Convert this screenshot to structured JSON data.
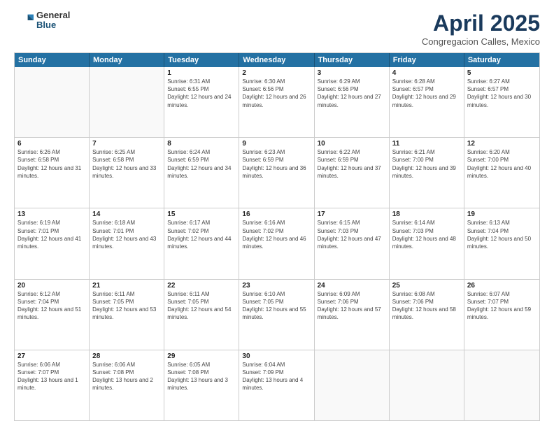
{
  "header": {
    "logo": {
      "general": "General",
      "blue": "Blue"
    },
    "title": "April 2025",
    "subtitle": "Congregacion Calles, Mexico"
  },
  "calendar": {
    "days_of_week": [
      "Sunday",
      "Monday",
      "Tuesday",
      "Wednesday",
      "Thursday",
      "Friday",
      "Saturday"
    ],
    "weeks": [
      {
        "cells": [
          {
            "day": "",
            "empty": true
          },
          {
            "day": "",
            "empty": true
          },
          {
            "day": "1",
            "sunrise": "6:31 AM",
            "sunset": "6:55 PM",
            "daylight": "12 hours and 24 minutes."
          },
          {
            "day": "2",
            "sunrise": "6:30 AM",
            "sunset": "6:56 PM",
            "daylight": "12 hours and 26 minutes."
          },
          {
            "day": "3",
            "sunrise": "6:29 AM",
            "sunset": "6:56 PM",
            "daylight": "12 hours and 27 minutes."
          },
          {
            "day": "4",
            "sunrise": "6:28 AM",
            "sunset": "6:57 PM",
            "daylight": "12 hours and 29 minutes."
          },
          {
            "day": "5",
            "sunrise": "6:27 AM",
            "sunset": "6:57 PM",
            "daylight": "12 hours and 30 minutes."
          }
        ]
      },
      {
        "cells": [
          {
            "day": "6",
            "sunrise": "6:26 AM",
            "sunset": "6:58 PM",
            "daylight": "12 hours and 31 minutes."
          },
          {
            "day": "7",
            "sunrise": "6:25 AM",
            "sunset": "6:58 PM",
            "daylight": "12 hours and 33 minutes."
          },
          {
            "day": "8",
            "sunrise": "6:24 AM",
            "sunset": "6:59 PM",
            "daylight": "12 hours and 34 minutes."
          },
          {
            "day": "9",
            "sunrise": "6:23 AM",
            "sunset": "6:59 PM",
            "daylight": "12 hours and 36 minutes."
          },
          {
            "day": "10",
            "sunrise": "6:22 AM",
            "sunset": "6:59 PM",
            "daylight": "12 hours and 37 minutes."
          },
          {
            "day": "11",
            "sunrise": "6:21 AM",
            "sunset": "7:00 PM",
            "daylight": "12 hours and 39 minutes."
          },
          {
            "day": "12",
            "sunrise": "6:20 AM",
            "sunset": "7:00 PM",
            "daylight": "12 hours and 40 minutes."
          }
        ]
      },
      {
        "cells": [
          {
            "day": "13",
            "sunrise": "6:19 AM",
            "sunset": "7:01 PM",
            "daylight": "12 hours and 41 minutes."
          },
          {
            "day": "14",
            "sunrise": "6:18 AM",
            "sunset": "7:01 PM",
            "daylight": "12 hours and 43 minutes."
          },
          {
            "day": "15",
            "sunrise": "6:17 AM",
            "sunset": "7:02 PM",
            "daylight": "12 hours and 44 minutes."
          },
          {
            "day": "16",
            "sunrise": "6:16 AM",
            "sunset": "7:02 PM",
            "daylight": "12 hours and 46 minutes."
          },
          {
            "day": "17",
            "sunrise": "6:15 AM",
            "sunset": "7:03 PM",
            "daylight": "12 hours and 47 minutes."
          },
          {
            "day": "18",
            "sunrise": "6:14 AM",
            "sunset": "7:03 PM",
            "daylight": "12 hours and 48 minutes."
          },
          {
            "day": "19",
            "sunrise": "6:13 AM",
            "sunset": "7:04 PM",
            "daylight": "12 hours and 50 minutes."
          }
        ]
      },
      {
        "cells": [
          {
            "day": "20",
            "sunrise": "6:12 AM",
            "sunset": "7:04 PM",
            "daylight": "12 hours and 51 minutes."
          },
          {
            "day": "21",
            "sunrise": "6:11 AM",
            "sunset": "7:05 PM",
            "daylight": "12 hours and 53 minutes."
          },
          {
            "day": "22",
            "sunrise": "6:11 AM",
            "sunset": "7:05 PM",
            "daylight": "12 hours and 54 minutes."
          },
          {
            "day": "23",
            "sunrise": "6:10 AM",
            "sunset": "7:05 PM",
            "daylight": "12 hours and 55 minutes."
          },
          {
            "day": "24",
            "sunrise": "6:09 AM",
            "sunset": "7:06 PM",
            "daylight": "12 hours and 57 minutes."
          },
          {
            "day": "25",
            "sunrise": "6:08 AM",
            "sunset": "7:06 PM",
            "daylight": "12 hours and 58 minutes."
          },
          {
            "day": "26",
            "sunrise": "6:07 AM",
            "sunset": "7:07 PM",
            "daylight": "12 hours and 59 minutes."
          }
        ]
      },
      {
        "cells": [
          {
            "day": "27",
            "sunrise": "6:06 AM",
            "sunset": "7:07 PM",
            "daylight": "13 hours and 1 minute."
          },
          {
            "day": "28",
            "sunrise": "6:06 AM",
            "sunset": "7:08 PM",
            "daylight": "13 hours and 2 minutes."
          },
          {
            "day": "29",
            "sunrise": "6:05 AM",
            "sunset": "7:08 PM",
            "daylight": "13 hours and 3 minutes."
          },
          {
            "day": "30",
            "sunrise": "6:04 AM",
            "sunset": "7:09 PM",
            "daylight": "13 hours and 4 minutes."
          },
          {
            "day": "",
            "empty": true
          },
          {
            "day": "",
            "empty": true
          },
          {
            "day": "",
            "empty": true
          }
        ]
      }
    ]
  }
}
